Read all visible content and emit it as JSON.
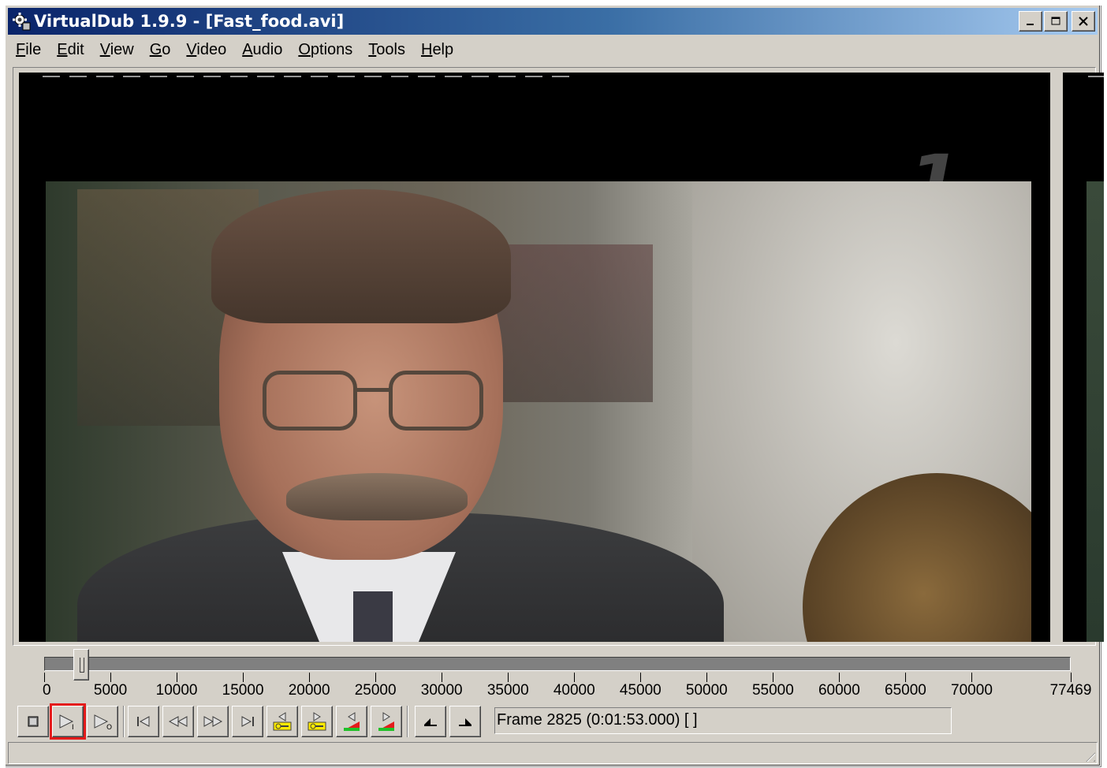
{
  "window": {
    "title": "VirtualDub 1.9.9 - [Fast_food.avi]",
    "app_icon": "virtualdub-gear-icon",
    "caption_buttons": [
      "minimize-icon",
      "maximize-icon",
      "close-icon"
    ]
  },
  "menu": [
    {
      "mnemonic": "F",
      "rest": "ile"
    },
    {
      "mnemonic": "E",
      "rest": "dit"
    },
    {
      "mnemonic": "V",
      "rest": "iew"
    },
    {
      "mnemonic": "G",
      "rest": "o"
    },
    {
      "mnemonic": "V",
      "rest": "ideo"
    },
    {
      "mnemonic": "A",
      "rest": "udio"
    },
    {
      "mnemonic": "O",
      "rest": "ptions"
    },
    {
      "mnemonic": "T",
      "rest": "ools"
    },
    {
      "mnemonic": "H",
      "rest": "elp"
    }
  ],
  "video": {
    "channel_logo": "1"
  },
  "timeline": {
    "min": 0,
    "max": 77469,
    "current_frame": 2825,
    "tick_labels": [
      "0",
      "5000",
      "10000",
      "15000",
      "20000",
      "25000",
      "30000",
      "35000",
      "40000",
      "45000",
      "50000",
      "55000",
      "60000",
      "65000",
      "70000",
      "77469"
    ]
  },
  "toolbar": {
    "buttons": [
      "stop-icon",
      "play-input-icon",
      "play-output-icon",
      "go-to-start-icon",
      "step-back-icon",
      "step-forward-icon",
      "go-to-end-icon",
      "prev-keyframe-icon",
      "next-keyframe-icon",
      "prev-scene-icon",
      "next-scene-icon",
      "mark-in-icon",
      "mark-out-icon"
    ],
    "highlight_color": "#e41b1b",
    "frame_status": "Frame 2825 (0:01:53.000) [ ]"
  },
  "status_bar": {
    "text": ""
  }
}
